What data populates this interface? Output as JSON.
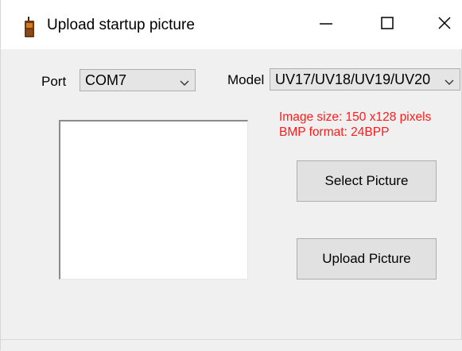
{
  "window": {
    "title": "Upload startup picture",
    "icon": "radio-icon",
    "controls": [
      "minimize-icon",
      "maximize-icon",
      "close-icon"
    ]
  },
  "port": {
    "label": "Port",
    "selected": "COM7"
  },
  "model": {
    "label": "Model",
    "selected": "UV17/UV18/UV19/UV20"
  },
  "info": {
    "image_size": "Image size: 150 x128 pixels",
    "bmp_format": "BMP format: 24BPP",
    "color": "#ff1a1a"
  },
  "buttons": {
    "select_picture": "Select Picture",
    "upload_picture": "Upload Picture"
  }
}
